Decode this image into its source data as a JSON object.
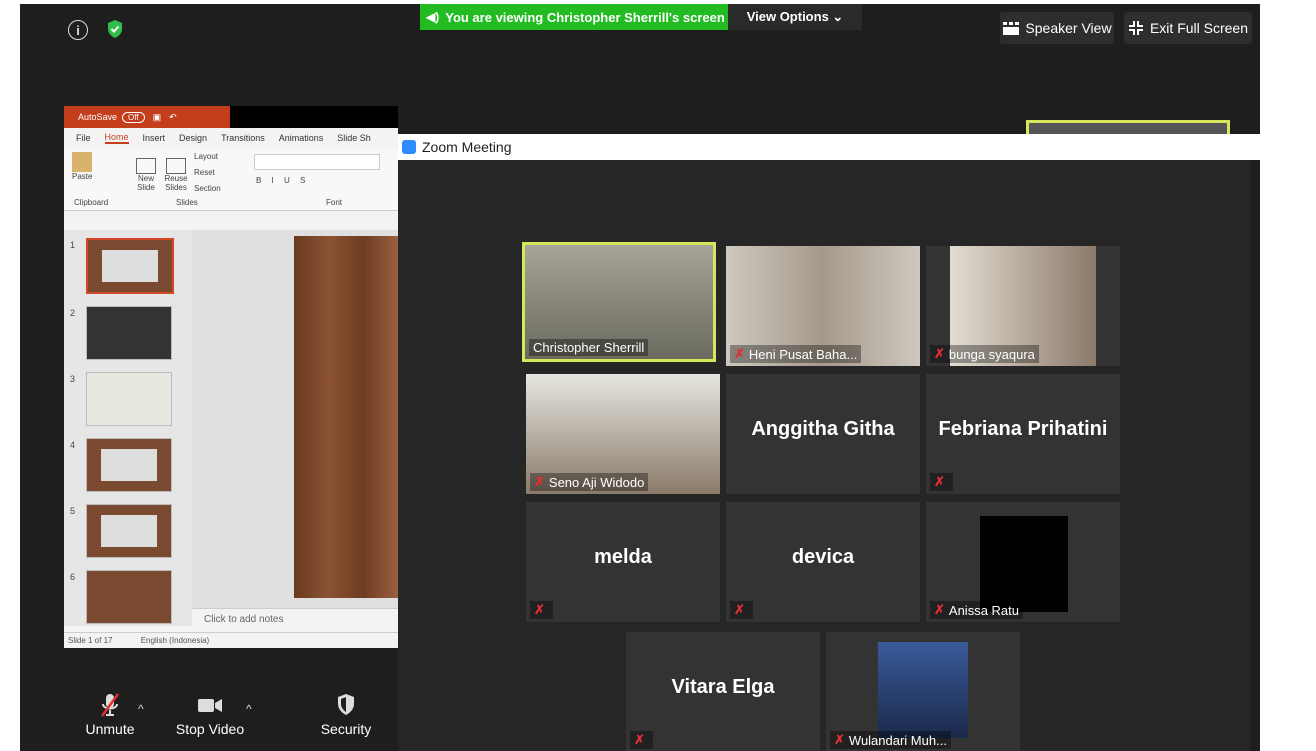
{
  "banner": {
    "text": "You are viewing Christopher Sherrill's screen",
    "view_options": "View Options ⌄"
  },
  "top_buttons": {
    "speaker_view": "Speaker View",
    "exit_full_screen": "Exit Full Screen"
  },
  "ppt": {
    "autosave": "AutoSave",
    "autosave_state": "Off",
    "menu": [
      "File",
      "Home",
      "Insert",
      "Design",
      "Transitions",
      "Animations",
      "Slide Sh"
    ],
    "ribbon": {
      "paste": "Paste",
      "new_slide": "New Slide",
      "reuse_slides": "Reuse Slides",
      "layout": "Layout",
      "reset": "Reset",
      "section": "Section",
      "clipboard": "Clipboard",
      "slides": "Slides",
      "font": "Font"
    },
    "slide_numbers": [
      "1",
      "2",
      "3",
      "4",
      "5",
      "6"
    ],
    "notes_placeholder": "Click to add notes",
    "status": "Slide 1 of 17",
    "language": "English (Indonesia)"
  },
  "zoom_window_title": "Zoom Meeting",
  "participants": [
    {
      "name": "Christopher Sherrill",
      "muted": false,
      "video": true,
      "active": true
    },
    {
      "name": "Heni Pusat Baha...",
      "muted": true,
      "video": true
    },
    {
      "name": "bunga syaqura",
      "muted": true,
      "video": true
    },
    {
      "name": "Seno Aji Widodo",
      "muted": true,
      "video": true
    },
    {
      "name": "Anggitha Githa",
      "muted": true,
      "video": false
    },
    {
      "name": "Febriana Prihatini",
      "muted": true,
      "video": false
    },
    {
      "name": "melda",
      "muted": true,
      "video": false
    },
    {
      "name": "devica",
      "muted": true,
      "video": false
    },
    {
      "name": "Anissa Ratu",
      "muted": true,
      "video": true
    },
    {
      "name": "Vitara Elga",
      "muted": true,
      "video": false
    },
    {
      "name": "Wulandari Muh...",
      "muted": true,
      "video": true
    }
  ],
  "toolbar": {
    "unmute": "Unmute",
    "stop_video": "Stop Video",
    "security": "Security"
  },
  "colors": {
    "banner_green": "#22bb22",
    "active_speaker": "#d6e85a",
    "mute_red": "#e03030",
    "ppt_accent": "#c43e1c"
  }
}
